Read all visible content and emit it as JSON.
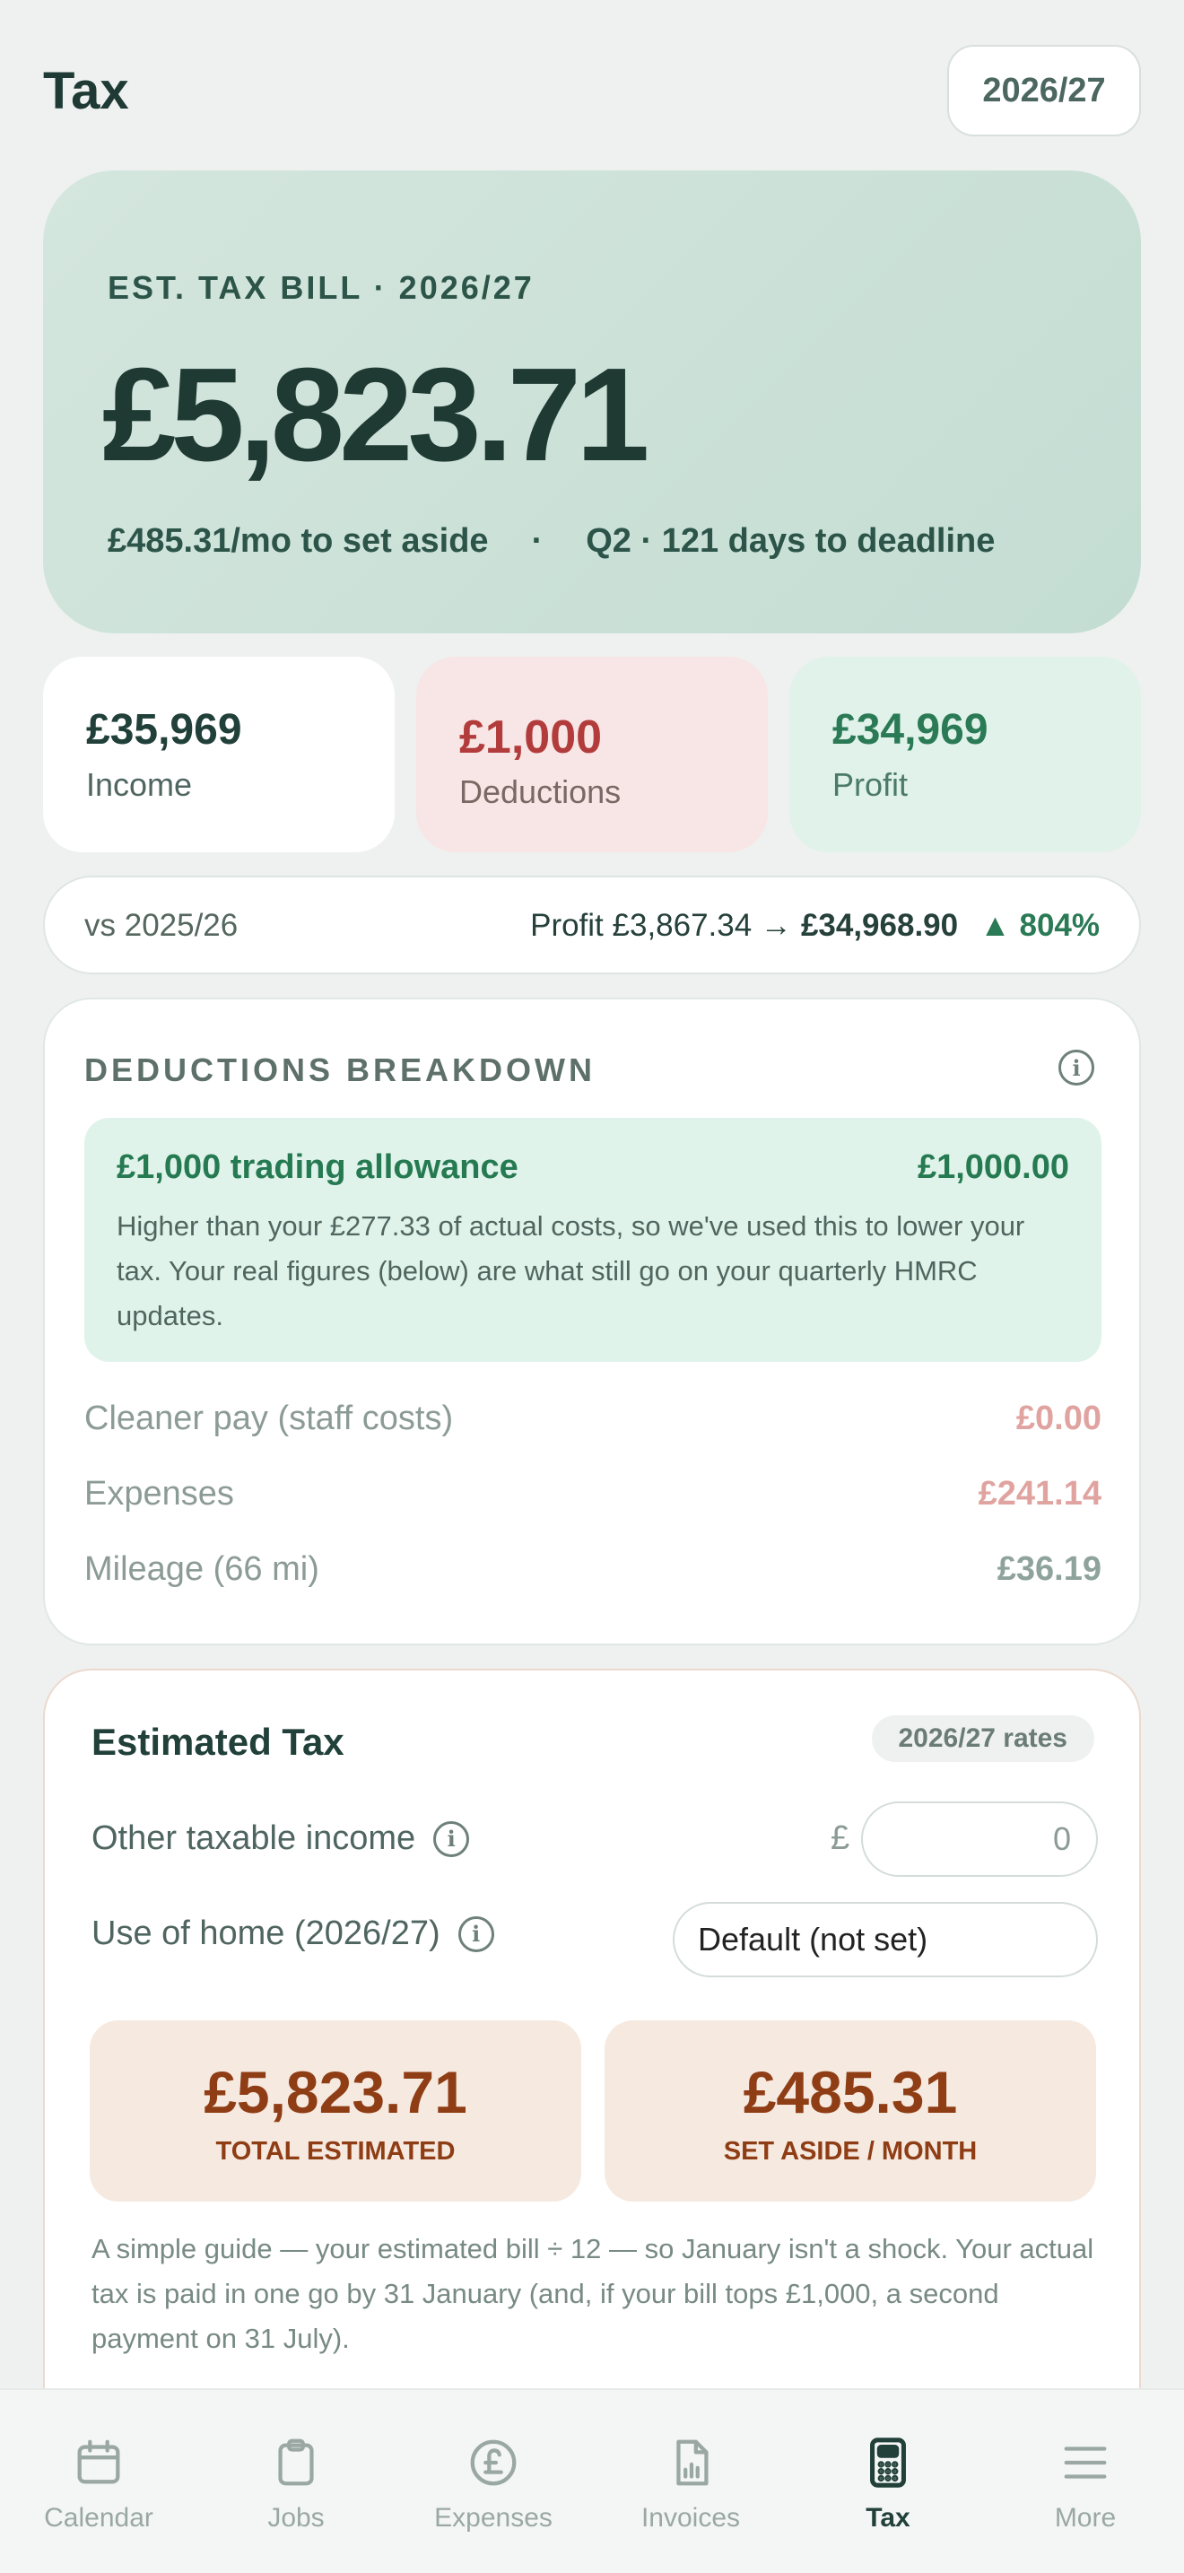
{
  "header": {
    "title": "Tax",
    "year_selector": "2026/27"
  },
  "hero": {
    "label": "EST. TAX BILL · 2026/27",
    "amount": "£5,823.71",
    "monthly": "£485.31/mo to set aside",
    "separator": "·",
    "deadline": "Q2 · 121 days to deadline"
  },
  "stats": {
    "income": {
      "value": "£35,969",
      "label": "Income"
    },
    "deductions": {
      "value": "£1,000",
      "label": "Deductions"
    },
    "profit": {
      "value": "£34,969",
      "label": "Profit"
    }
  },
  "comparison": {
    "label": "vs 2025/26",
    "prefix": "Profit £3,867.34 →",
    "current": "£34,968.90",
    "change": "▲ 804%"
  },
  "breakdown": {
    "title": "DEDUCTIONS BREAKDOWN",
    "allowance": {
      "title": "£1,000 trading allowance",
      "amount": "£1,000.00",
      "description": "Higher than your £277.33 of actual costs, so we've used this to lower your tax. Your real figures (below) are what still go on your quarterly HMRC updates."
    },
    "rows": [
      {
        "name": "Cleaner pay (staff costs)",
        "amount": "£0.00"
      },
      {
        "name": "Expenses",
        "amount": "£241.14"
      },
      {
        "name": "Mileage (66 mi)",
        "amount": "£36.19"
      }
    ]
  },
  "estimated": {
    "title": "Estimated Tax",
    "rates_badge": "2026/27 rates",
    "other_income_label": "Other taxable income",
    "currency_symbol": "£",
    "other_income_value": "0",
    "home_label": "Use of home (2026/27)",
    "home_value": "Default (not set)",
    "total": {
      "value": "£5,823.71",
      "label": "TOTAL ESTIMATED"
    },
    "monthly": {
      "value": "£485.31",
      "label": "SET ASIDE / MONTH"
    },
    "note": "A simple guide — your estimated bill ÷ 12 — so January isn't a shock. Your actual tax is paid in one go by 31 January (and, if your bill tops £1,000, a second payment on 31 July)."
  },
  "nav": {
    "items": [
      {
        "label": "Calendar",
        "icon": "calendar-icon"
      },
      {
        "label": "Jobs",
        "icon": "clipboard-icon"
      },
      {
        "label": "Expenses",
        "icon": "pound-icon"
      },
      {
        "label": "Invoices",
        "icon": "document-chart-icon"
      },
      {
        "label": "Tax",
        "icon": "calculator-icon",
        "active": true
      },
      {
        "label": "More",
        "icon": "menu-icon"
      }
    ]
  },
  "colors": {
    "accent_green": "#267a52",
    "deduction_red": "#b23b3b",
    "tax_brown": "#8f3d14"
  }
}
